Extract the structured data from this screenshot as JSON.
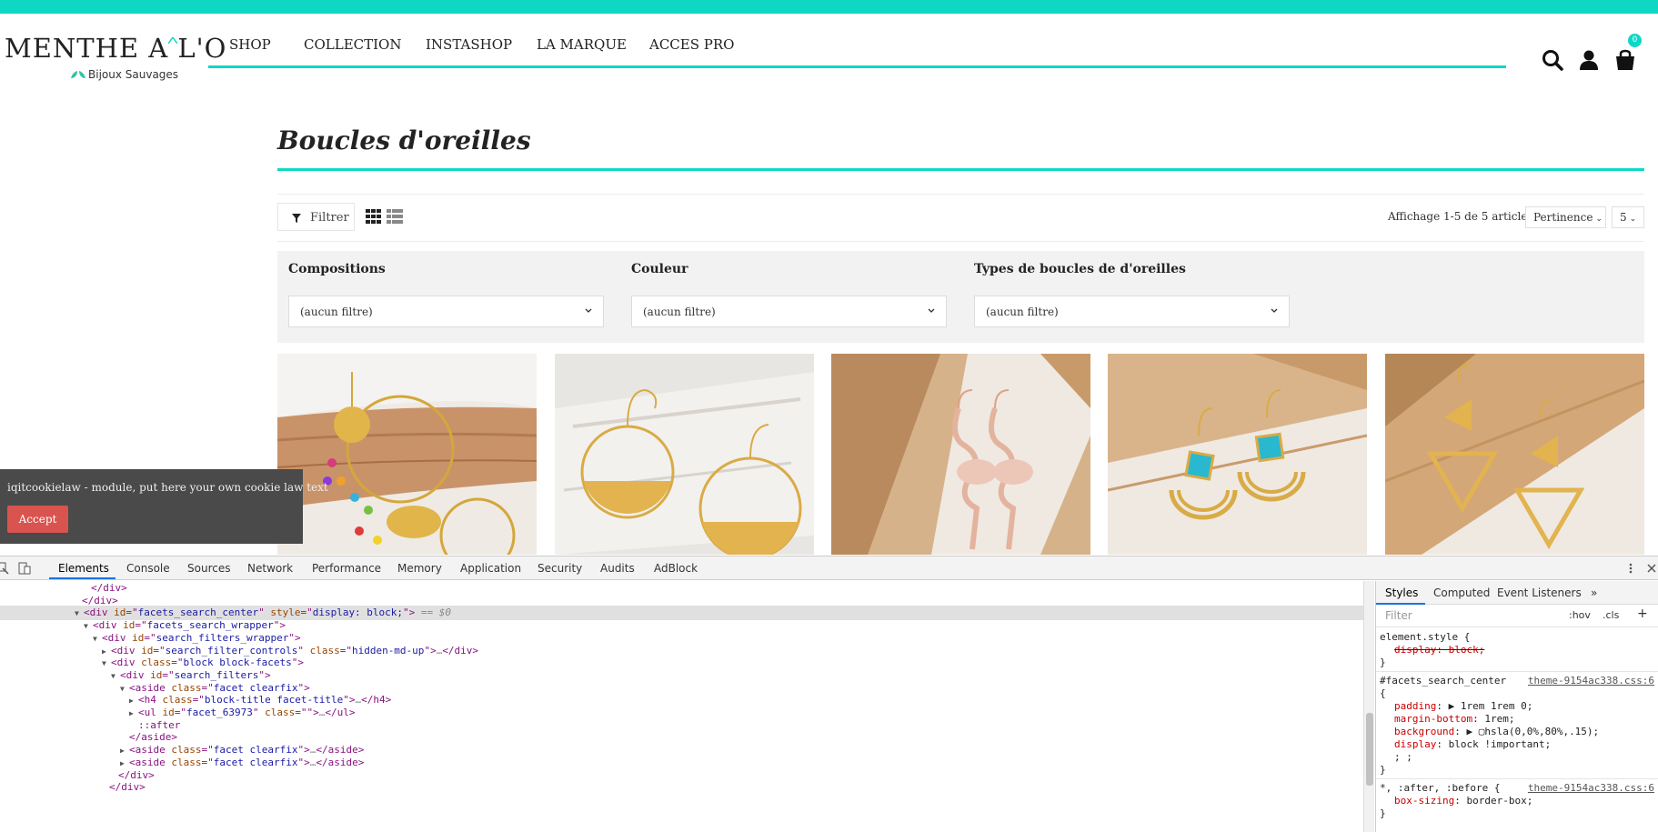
{
  "header": {
    "brand_name": "MENTHE A L'O",
    "brand_tagline": "Bijoux Sauvages",
    "nav": [
      "SHOP",
      "COLLECTION",
      "INSTASHOP",
      "LA MARQUE",
      "ACCES PRO"
    ],
    "cart_count": "0",
    "accent_color": "#0ed8c4"
  },
  "page": {
    "title": "Boucles d'oreilles"
  },
  "toolbar": {
    "filter_label": "Filtrer",
    "showing": "Affichage 1-5 de 5 article(s)",
    "sort_value": "Pertinence",
    "per_page_value": "5"
  },
  "facets": [
    {
      "title": "Compositions",
      "value": "(aucun filtre)"
    },
    {
      "title": "Couleur",
      "value": "(aucun filtre)"
    },
    {
      "title": "Types de boucles de d'oreilles",
      "value": "(aucun filtre)"
    }
  ],
  "products": [
    {
      "icon": "gold-hoop-colorful-leaves-earrings"
    },
    {
      "icon": "gold-hoop-half-moon-earrings"
    },
    {
      "icon": "rose-gold-flamingo-earrings"
    },
    {
      "icon": "turquoise-gold-arch-earrings"
    },
    {
      "icon": "gold-triangle-earrings"
    }
  ],
  "cookie": {
    "text": "iqitcookielaw - module, put here your own cookie law text",
    "accept_label": "Accept"
  },
  "devtools": {
    "tabs": [
      "Elements",
      "Console",
      "Sources",
      "Network",
      "Performance",
      "Memory",
      "Application",
      "Security",
      "Audits",
      "AdBlock"
    ],
    "active_tab": "Elements",
    "dom_lines": [
      {
        "tri": "",
        "html": "</div>"
      },
      {
        "tri": "",
        "html": "</div>"
      },
      {
        "tri": "▼",
        "open": "div",
        "attrs": [
          [
            "id",
            "facets_search_center"
          ],
          [
            "style",
            "display: block;"
          ]
        ],
        "suffix": " == $0"
      },
      {
        "tri": "▼",
        "open": "div",
        "attrs": [
          [
            "id",
            "facets_search_wrapper"
          ]
        ]
      },
      {
        "tri": "▼",
        "open": "div",
        "attrs": [
          [
            "id",
            "search_filters_wrapper"
          ]
        ]
      },
      {
        "tri": "▶",
        "open": "div",
        "attrs": [
          [
            "id",
            "search_filter_controls"
          ],
          [
            "class",
            "hidden-md-up"
          ]
        ],
        "close": "div"
      },
      {
        "tri": "▼",
        "open": "div",
        "attrs": [
          [
            "class",
            "block block-facets"
          ]
        ]
      },
      {
        "tri": "▼",
        "open": "div",
        "attrs": [
          [
            "id",
            "search_filters"
          ]
        ]
      },
      {
        "tri": "▼",
        "open": "aside",
        "attrs": [
          [
            "class",
            "facet clearfix"
          ]
        ]
      },
      {
        "tri": "▶",
        "open": "h4",
        "attrs": [
          [
            "class",
            "block-title facet-title"
          ]
        ],
        "close": "h4"
      },
      {
        "tri": "▶",
        "open": "ul",
        "attrs": [
          [
            "id",
            "facet_63973"
          ],
          [
            "class",
            ""
          ]
        ],
        "close": "ul"
      },
      {
        "tri": "",
        "pseudo": "::after"
      },
      {
        "tri": "",
        "html": "</aside>"
      },
      {
        "tri": "▶",
        "open": "aside",
        "attrs": [
          [
            "class",
            "facet clearfix"
          ]
        ],
        "close": "aside"
      },
      {
        "tri": "▶",
        "open": "aside",
        "attrs": [
          [
            "class",
            "facet clearfix"
          ]
        ],
        "close": "aside"
      },
      {
        "tri": "",
        "html": "</div>"
      },
      {
        "tri": "",
        "html": "</div>"
      }
    ],
    "styles_tabs": [
      "Styles",
      "Computed",
      "Event Listeners"
    ],
    "filter_placeholder": "Filter",
    "hov": ":hov",
    "cls": ".cls",
    "element_style": "element.style {",
    "element_style_prop": "display: block;",
    "rule1_selector": "#facets_search_center",
    "rule1_source": "theme-9154ac338.css:6",
    "rule1_props": [
      [
        "padding",
        "▶ 1rem 1rem 0;"
      ],
      [
        "margin-bottom",
        "1rem;"
      ],
      [
        "background",
        "▶ ▢hsla(0,0%,80%,.15);"
      ],
      [
        "display",
        "block !important;"
      ]
    ],
    "rule2_selector": "*, :after, :before {",
    "rule2_source": "theme-9154ac338.css:6",
    "rule2_prop": [
      "box-sizing",
      "border-box;"
    ]
  }
}
